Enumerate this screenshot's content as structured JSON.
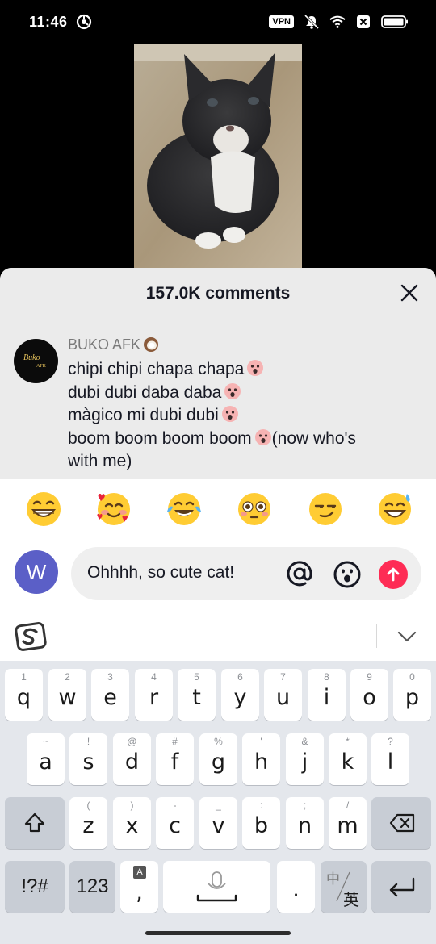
{
  "status": {
    "time": "11:46",
    "vpn": "VPN"
  },
  "sheet": {
    "title": "157.0K comments"
  },
  "comment": {
    "author": "BUKO AFK",
    "avatar_text_top": "Buko",
    "avatar_text_bottom": "AFK",
    "lines": [
      "chipi chipi chapa chapa",
      "dubi dubi daba daba",
      "màgico mi dubi dubi",
      "boom boom boom boom",
      "(now who's",
      "with me)"
    ]
  },
  "composer": {
    "emojis": [
      "😁",
      "🥰",
      "😂",
      "😳",
      "😏",
      "😅"
    ],
    "avatar_letter": "W",
    "input_value": "Ohhhh, so cute cat!"
  },
  "keyboard": {
    "row1": [
      {
        "key": "q",
        "hint": "1"
      },
      {
        "key": "w",
        "hint": "2"
      },
      {
        "key": "e",
        "hint": "3"
      },
      {
        "key": "r",
        "hint": "4"
      },
      {
        "key": "t",
        "hint": "5"
      },
      {
        "key": "y",
        "hint": "6"
      },
      {
        "key": "u",
        "hint": "7"
      },
      {
        "key": "i",
        "hint": "8"
      },
      {
        "key": "o",
        "hint": "9"
      },
      {
        "key": "p",
        "hint": "0"
      }
    ],
    "row2": [
      {
        "key": "a",
        "hint": "~"
      },
      {
        "key": "s",
        "hint": "!"
      },
      {
        "key": "d",
        "hint": "@"
      },
      {
        "key": "f",
        "hint": "#"
      },
      {
        "key": "g",
        "hint": "%"
      },
      {
        "key": "h",
        "hint": "'"
      },
      {
        "key": "j",
        "hint": "&"
      },
      {
        "key": "k",
        "hint": "*"
      },
      {
        "key": "l",
        "hint": "?"
      }
    ],
    "row3": [
      {
        "key": "z",
        "hint": "("
      },
      {
        "key": "x",
        "hint": ")"
      },
      {
        "key": "c",
        "hint": "-"
      },
      {
        "key": "v",
        "hint": "_"
      },
      {
        "key": "b",
        "hint": ":"
      },
      {
        "key": "n",
        "hint": ";"
      },
      {
        "key": "m",
        "hint": "/"
      }
    ],
    "symbols_label": "!?#",
    "numbers_label": "123",
    "comma_label": ",",
    "comma_hint": "A",
    "period_label": ".",
    "lang_top": "中",
    "lang_bottom": "英"
  }
}
